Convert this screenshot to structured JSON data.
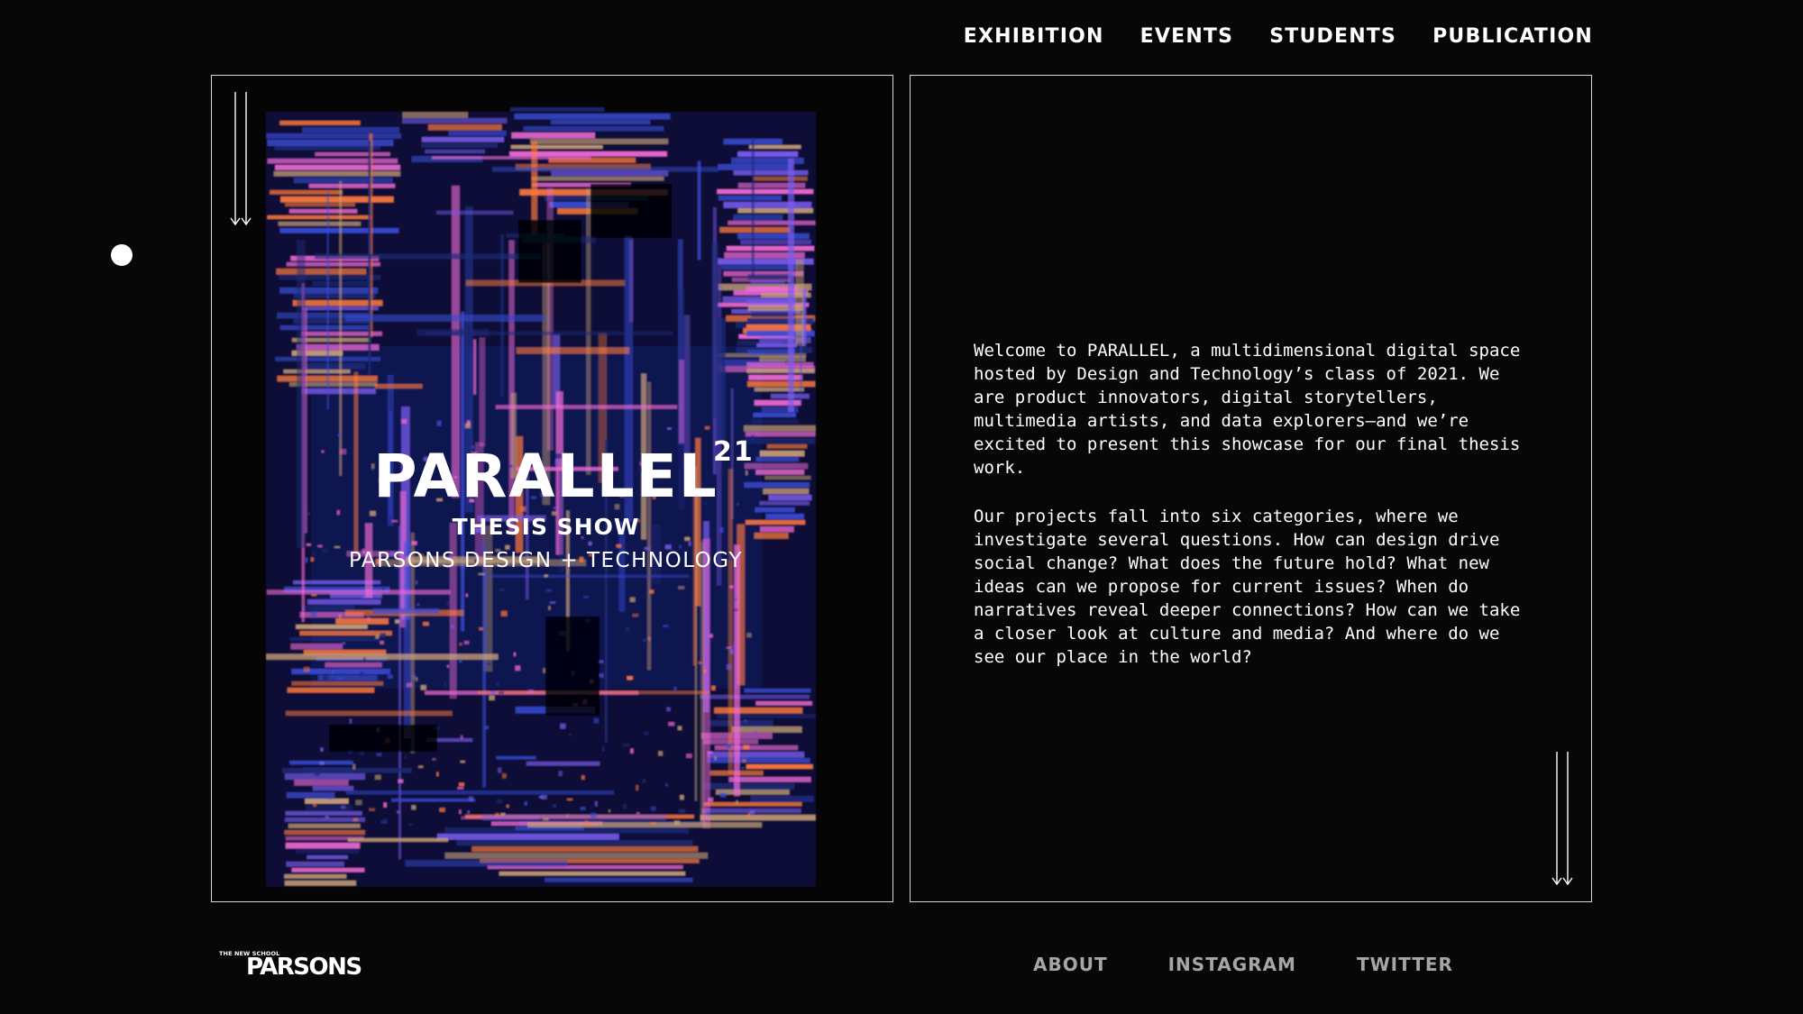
{
  "nav": {
    "items": [
      {
        "label": "EXHIBITION"
      },
      {
        "label": "EVENTS"
      },
      {
        "label": "STUDENTS"
      },
      {
        "label": "PUBLICATION"
      }
    ]
  },
  "poster": {
    "title": "PARALLEL",
    "superscript": "21",
    "subtitle": "THESIS SHOW",
    "school": "PARSONS DESIGN + TECHNOLOGY"
  },
  "intro": {
    "paragraphs": [
      "Welcome to PARALLEL, a multidimensional digital space hosted by Design and Technology’s class of 2021. We are product innovators, digital storytellers, multimedia artists, and data explorers—and we’re excited to present this showcase for our final thesis work.",
      "Our projects fall into six categories, where we investigate several questions. How can design drive social change? What does the future hold? What new ideas can we propose for current issues? When do narratives reveal deeper connections? How can we take a closer look at culture and media? And where do we see our place in the world?"
    ]
  },
  "logo": {
    "small": "THE NEW SCHOOL",
    "big": "PARSONS"
  },
  "footer": {
    "links": [
      {
        "label": "ABOUT"
      },
      {
        "label": "INSTAGRAM"
      },
      {
        "label": "TWITTER"
      }
    ]
  },
  "colors": {
    "background": "#070707",
    "border": "#d8d8d8",
    "text": "#ffffff",
    "footer_link": "#a6a6a6",
    "glitch_palette": [
      "#ff7a3d",
      "#f06ad8",
      "#3a4bd6",
      "#7a5cf0",
      "#c9a07a",
      "#1d2a7a"
    ]
  },
  "icons": {
    "scroll_arrows": "double-down-arrow-icon",
    "side_dot": "circle-dot-icon"
  }
}
